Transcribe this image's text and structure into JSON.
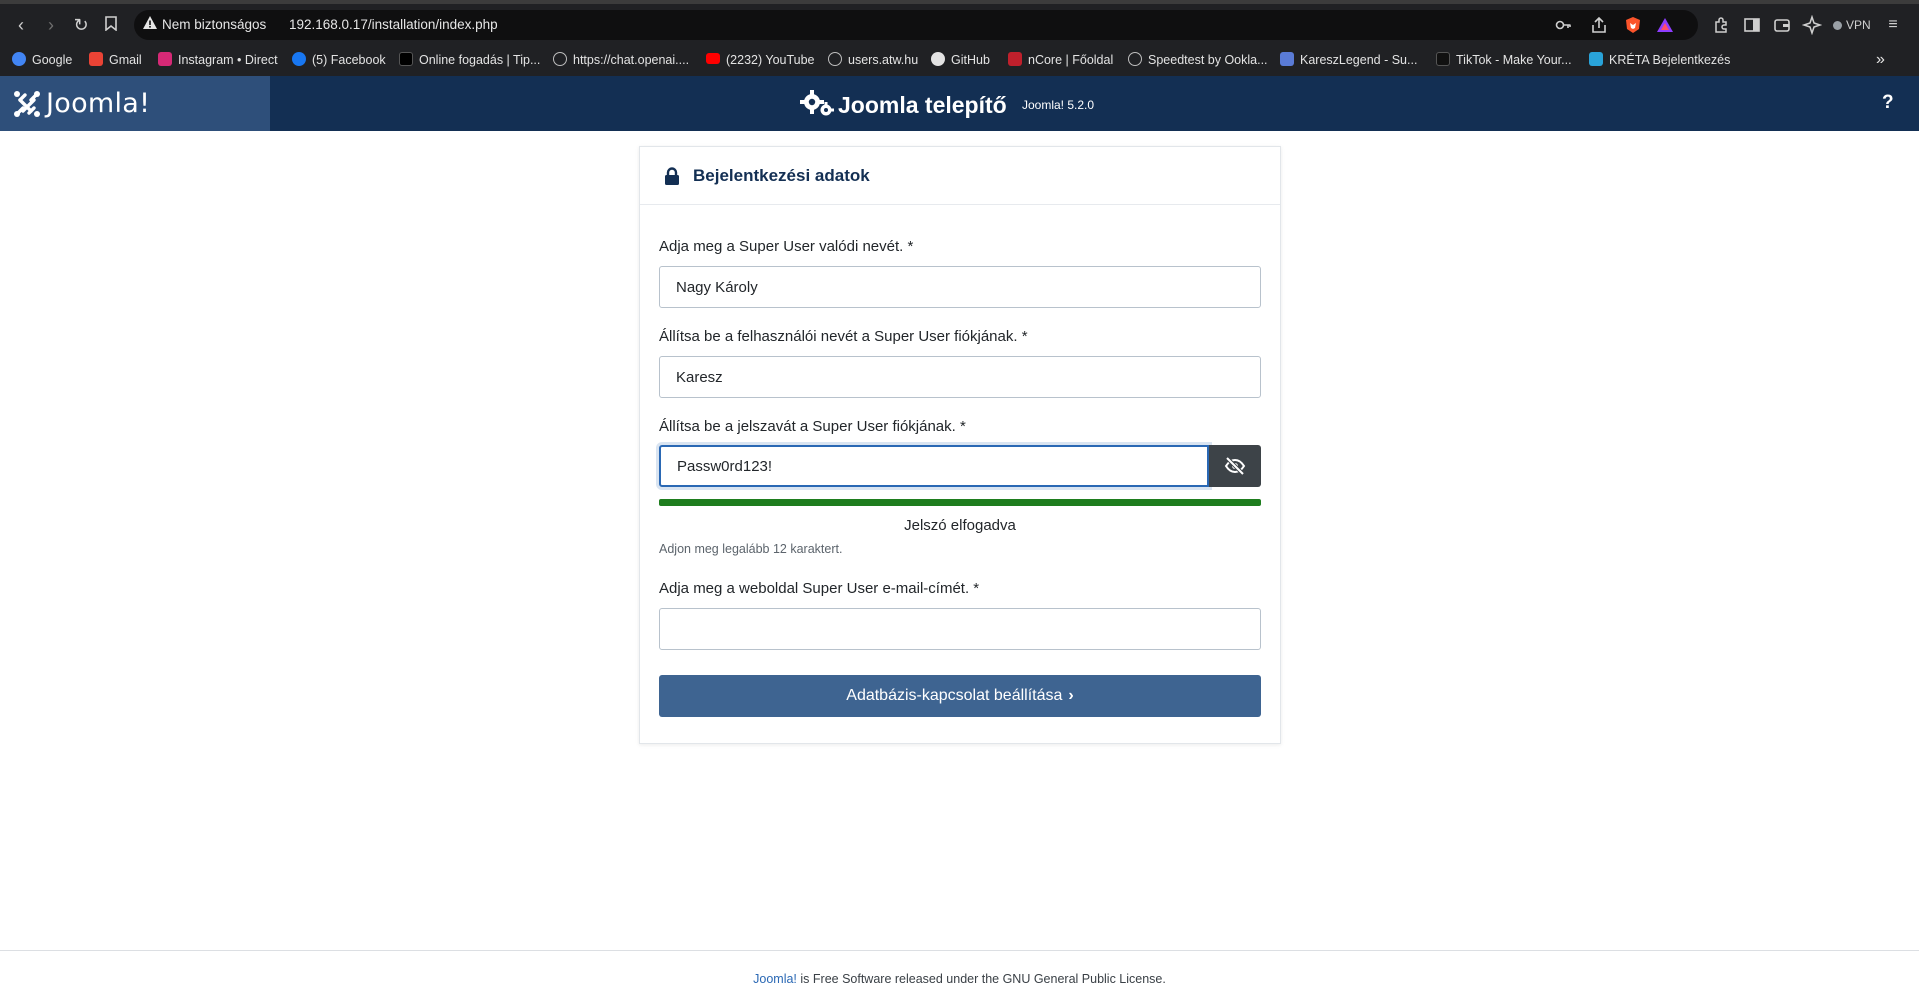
{
  "browser": {
    "security_label": "Nem biztonságos",
    "url": "192.168.0.17/installation/index.php",
    "vpn_label": "VPN",
    "bookmarks": [
      {
        "label": "Google",
        "color": "#4285f4"
      },
      {
        "label": "Gmail",
        "color": "#ea4335"
      },
      {
        "label": "Instagram • Direct",
        "color": "#d62976"
      },
      {
        "label": "(5) Facebook",
        "color": "#1877f2"
      },
      {
        "label": "Online fogadás | Tip...",
        "color": "#000000"
      },
      {
        "label": "https://chat.openai....",
        "color": "#5f6368"
      },
      {
        "label": "(2232) YouTube",
        "color": "#ff0000"
      },
      {
        "label": "users.atw.hu",
        "color": "#5f6368"
      },
      {
        "label": "GitHub",
        "color": "#ffffff"
      },
      {
        "label": "nCore | Főoldal",
        "color": "#c0202c"
      },
      {
        "label": "Speedtest by Ookla...",
        "color": "#5f6368"
      },
      {
        "label": "KareszLegend - Su...",
        "color": "#5a7bd6"
      },
      {
        "label": "TikTok - Make Your...",
        "color": "#111111"
      },
      {
        "label": "KRÉTA Bejelentkezés",
        "color": "#29a3d9"
      }
    ]
  },
  "header": {
    "logo_text": "Joomla!",
    "title": "Joomla telepítő",
    "version": "Joomla! 5.2.0",
    "help_label": "?"
  },
  "card": {
    "title": "Bejelentkezési adatok",
    "fields": {
      "real_name": {
        "label": "Adja meg a Super User valódi nevét. *",
        "value": "Nagy Károly"
      },
      "username": {
        "label": "Állítsa be a felhasználói nevét a Super User fiókjának. *",
        "value": "Karesz"
      },
      "password": {
        "label": "Állítsa be a jelszavát a Super User fiókjának. *",
        "value": "Passw0rd123!"
      },
      "email": {
        "label": "Adja meg a weboldal Super User e-mail-címét. *",
        "value": ""
      }
    },
    "password_strength": 1.0,
    "password_status": "Jelszó elfogadva",
    "password_hint": "Adjon meg legalább 12 karaktert.",
    "submit_label": "Adatbázis-kapcsolat beállítása",
    "submit_icon": "chevron-right-icon"
  },
  "footer": {
    "link_text": "Joomla!",
    "text": " is Free Software released under the GNU General Public License."
  },
  "colors": {
    "header_bg": "#132f53",
    "logo_bg": "#2e4f7a",
    "button_bg": "#3e6491",
    "strength_ok": "#1e7d1e",
    "focus": "#2a68b4"
  }
}
